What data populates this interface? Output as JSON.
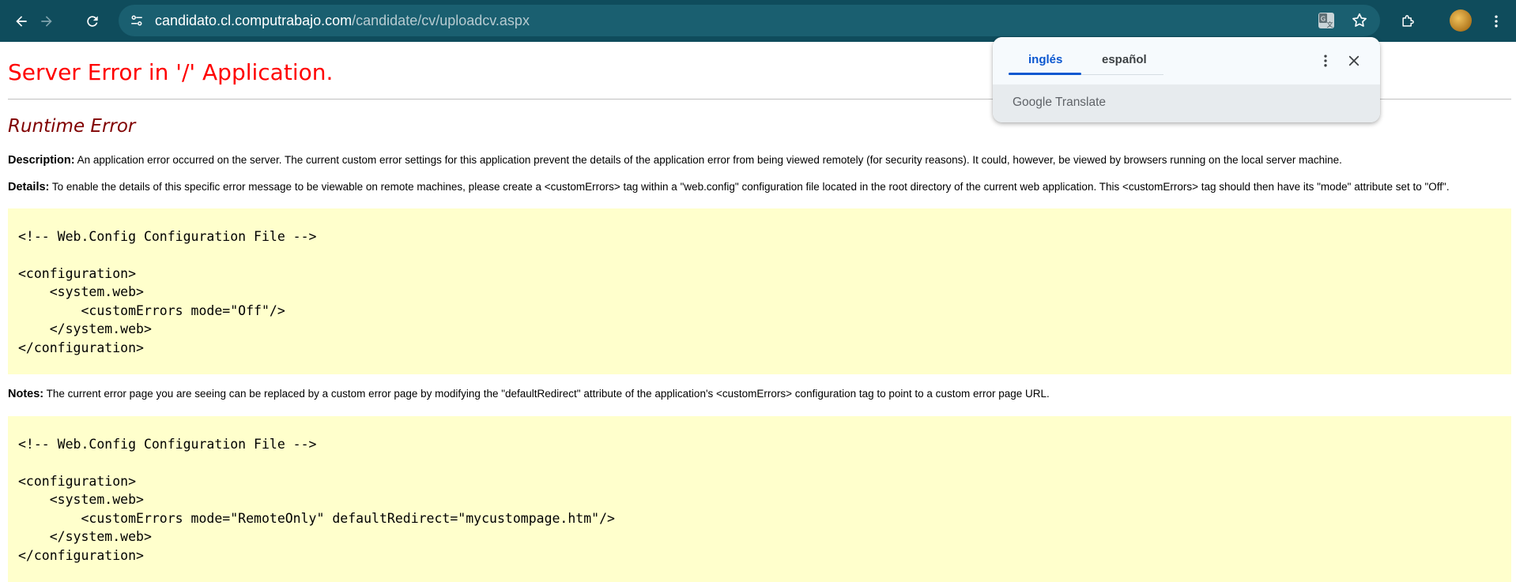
{
  "browser": {
    "url_host": "candidato.cl.computrabajo.com",
    "url_path": "/candidate/cv/uploadcv.aspx",
    "icons": {
      "back": "arrow-left-icon",
      "forward": "arrow-right-icon",
      "reload": "reload-icon",
      "site_info": "tune-icon",
      "translate": "translate-icon",
      "bookmark": "star-icon",
      "extensions": "puzzle-icon",
      "menu": "kebab-menu-icon"
    }
  },
  "translate_popup": {
    "tabs": [
      "inglés",
      "español"
    ],
    "active_tab": "inglés",
    "brand_google": "Google",
    "brand_translate": "Translate"
  },
  "page": {
    "title": "Server Error in '/' Application.",
    "subtitle": "Runtime Error",
    "description_label": "Description:",
    "description_text": "An application error occurred on the server. The current custom error settings for this application prevent the details of the application error from being viewed remotely (for security reasons). It could, however, be viewed by browsers running on the local server machine.",
    "details_label": "Details:",
    "details_text": "To enable the details of this specific error message to be viewable on remote machines, please create a <customErrors> tag within a \"web.config\" configuration file located in the root directory of the current web application. This <customErrors> tag should then have its \"mode\" attribute set to \"Off\".",
    "code_block_1": "\n<!-- Web.Config Configuration File -->\n\n<configuration>\n    <system.web>\n        <customErrors mode=\"Off\"/>\n    </system.web>\n</configuration>",
    "notes_label": "Notes:",
    "notes_text": "The current error page you are seeing can be replaced by a custom error page by modifying the \"defaultRedirect\" attribute of the application's <customErrors> configuration tag to point to a custom error page URL.",
    "code_block_2": "\n<!-- Web.Config Configuration File -->\n\n<configuration>\n    <system.web>\n        <customErrors mode=\"RemoteOnly\" defaultRedirect=\"mycustompage.htm\"/>\n    </system.web>\n</configuration>"
  },
  "colors": {
    "toolbar": "#0f4c5c",
    "omnibox": "#1a5f70",
    "error_title": "#ff0000",
    "runtime_error": "#800000",
    "code_background": "#ffffcc",
    "translate_accent": "#0b57d0"
  }
}
